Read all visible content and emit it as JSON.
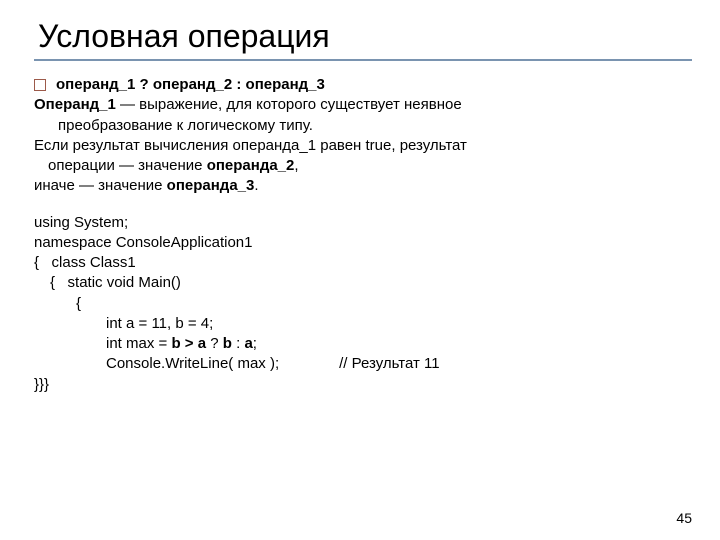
{
  "title": "Условная операция",
  "syntax": {
    "op1": "операнд_1",
    "q": " ? ",
    "op2": "операнд_2",
    "colon": " : ",
    "op3": "операнд_3"
  },
  "desc": {
    "line1_a": "Операнд_1",
    "line1_b": " — выражение, для которого существует неявное",
    "line2": "преобразование к логическому типу.",
    "line3_a": "Если результат вычисления операнда_1 равен true, результат",
    "line4_a": "операции — значение ",
    "line4_b": "операнда_2",
    "line4_c": ",",
    "line5_a": "иначе — значение ",
    "line5_b": "операнда_3",
    "line5_c": "."
  },
  "code": {
    "l1": "using System;",
    "l2": "namespace ConsoleApplication1",
    "l3_a": "{",
    "l3_b": "class Class1",
    "l4_a": "{",
    "l4_b": "static void Main()",
    "l5": "{",
    "l6": "int a = 11, b = 4;",
    "l7_a": "int max = ",
    "l7_b": "b > a",
    "l7_c": " ? ",
    "l7_d": "b",
    "l7_e": " : ",
    "l7_f": "a",
    "l7_g": ";",
    "l8_a": "Console.WriteLine( max );",
    "l8_b": "// Результат 11",
    "l9": "}}}"
  },
  "page": "45"
}
